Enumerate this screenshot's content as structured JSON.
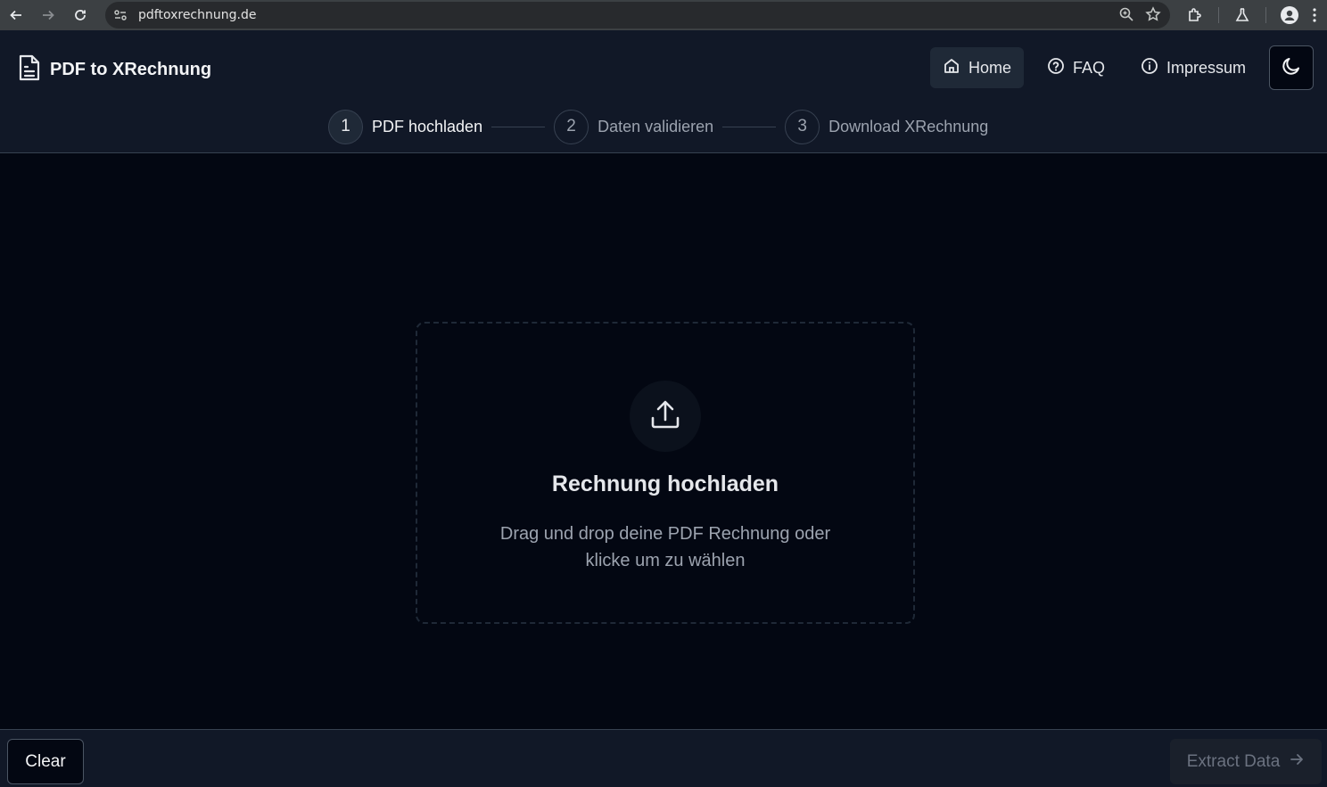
{
  "browser": {
    "url": "pdftoxrechnung.de"
  },
  "header": {
    "brand_title": "PDF to XRechnung",
    "nav": [
      {
        "label": "Home",
        "icon": "home-icon"
      },
      {
        "label": "FAQ",
        "icon": "help-circle-icon"
      },
      {
        "label": "Impressum",
        "icon": "info-icon"
      }
    ],
    "theme_icon": "moon-icon"
  },
  "stepper": {
    "steps": [
      {
        "number": "1",
        "label": "PDF hochladen"
      },
      {
        "number": "2",
        "label": "Daten validieren"
      },
      {
        "number": "3",
        "label": "Download XRechnung"
      }
    ]
  },
  "dropzone": {
    "icon": "upload-icon",
    "title": "Rechnung hochladen",
    "subtitle": "Drag und drop deine PDF Rechnung oder klicke um zu wählen"
  },
  "footer": {
    "clear_label": "Clear",
    "extract_label": "Extract Data"
  },
  "colors": {
    "background": "#030712",
    "header_bg": "#111827",
    "border": "#374151"
  }
}
